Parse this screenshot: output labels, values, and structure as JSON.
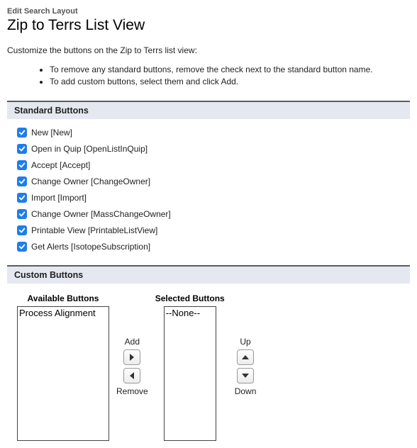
{
  "header": {
    "breadcrumb": "Edit Search Layout",
    "title": "Zip to Terrs List View"
  },
  "intro": "Customize the buttons on the Zip to Terrs list view:",
  "instructions": [
    "To remove any standard buttons, remove the check next to the standard button name.",
    "To add custom buttons, select them and click Add."
  ],
  "sections": {
    "standard": "Standard Buttons",
    "custom": "Custom Buttons"
  },
  "standard_buttons": [
    {
      "label": "New [New]",
      "checked": true
    },
    {
      "label": "Open in Quip [OpenListInQuip]",
      "checked": true
    },
    {
      "label": "Accept [Accept]",
      "checked": true
    },
    {
      "label": "Change Owner [ChangeOwner]",
      "checked": true
    },
    {
      "label": "Import [Import]",
      "checked": true
    },
    {
      "label": "Change Owner [MassChangeOwner]",
      "checked": true
    },
    {
      "label": "Printable View [PrintableListView]",
      "checked": true
    },
    {
      "label": "Get Alerts [IsotopeSubscription]",
      "checked": true
    }
  ],
  "custom_buttons": {
    "available_title": "Available Buttons",
    "selected_title": "Selected Buttons",
    "available": [
      "Process Alignment"
    ],
    "selected": [
      "--None--"
    ],
    "add_label": "Add",
    "remove_label": "Remove",
    "up_label": "Up",
    "down_label": "Down"
  }
}
